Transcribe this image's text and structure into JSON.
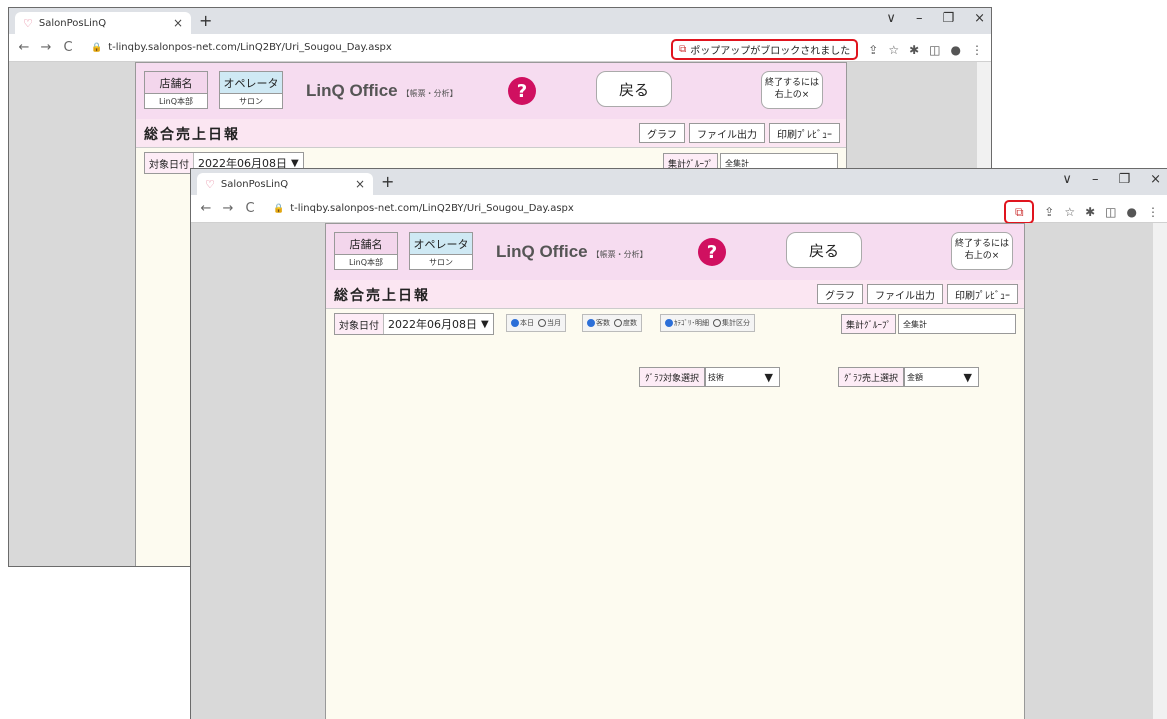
{
  "browser": {
    "tab_title": "SalonPosLinQ",
    "tab_close": "×",
    "new_tab": "+",
    "back": "←",
    "forward": "→",
    "reload": "C",
    "win_minimize": "–",
    "win_restore": "❐",
    "win_close": "×",
    "win_menu": "∨",
    "url_back": "t-linqby.salonpos-net.com/LinQ2BY/Uri_Sougou_Day.aspx",
    "url_front": "t-linqby.salonpos-net.com/LinQ2BY/Uri_Sougou_Day.aspx",
    "popup_blocked_text": "ポップアップがブロックされました"
  },
  "app": {
    "store_label": "店舗名",
    "store_value": "LinQ本部",
    "operator_label": "オペレータ",
    "operator_value": "サロン",
    "logo_main": "LinQ Office",
    "logo_sub": "【帳票・分析】",
    "help": "?",
    "back_button": "戻る",
    "exit_button": "終了するには\n右上の×",
    "page_title": "総合売上日報",
    "buttons": {
      "graph": "グラフ",
      "file_output": "ファイル出力",
      "print_preview": "印刷ﾌﾟﾚﾋﾞｭｰ"
    },
    "date_label": "対象日付",
    "date_value": "2022年06月08日",
    "date_arrow": "▼",
    "radio1": {
      "a": "本日",
      "b": "当月"
    },
    "radio2": {
      "a": "客数",
      "b": "度数"
    },
    "radio3": {
      "a": "ｶﾃｺﾞﾘ･明細",
      "b": "集計区分"
    },
    "group_label": "集計ｸﾞﾙｰﾌﾟ",
    "group_value": "全集計",
    "graph_target_label": "ｸﾞﾗﾌ対象選択",
    "graph_target_value": "技術",
    "graph_sales_label": "ｸﾞﾗﾌ売上選択",
    "graph_sales_value": "金額"
  },
  "colors": {
    "callout": "#e0141e",
    "header_pink": "#f6dcf0",
    "help_magenta": "#d01060",
    "radio_on": "#2c6fd8"
  }
}
